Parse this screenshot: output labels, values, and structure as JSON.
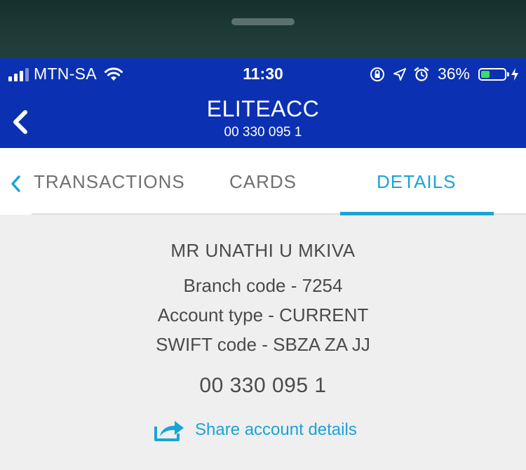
{
  "status_bar": {
    "carrier": "MTN-SA",
    "time": "11:30",
    "battery_percent": "36%",
    "battery_level": 0.36,
    "icons": [
      "signal-icon",
      "wifi-icon",
      "rotation-lock-icon",
      "location-icon",
      "alarm-icon",
      "battery-icon",
      "charging-icon"
    ]
  },
  "header": {
    "title": "ELITEACC",
    "account_number": "00 330 095 1"
  },
  "tabs": [
    {
      "label": "TRANSACTIONS",
      "active": false
    },
    {
      "label": "CARDS",
      "active": false
    },
    {
      "label": "DETAILS",
      "active": true
    }
  ],
  "details": {
    "holder_name": "MR UNATHI U MKIVA",
    "branch_code": "Branch code - 7254",
    "account_type": "Account type - CURRENT",
    "swift_code": "SWIFT code - SBZA ZA JJ",
    "account_number": "00 330 095 1",
    "share_label": "Share account details"
  },
  "colors": {
    "header_blue": "#0b31b2",
    "accent": "#1aa4d6",
    "battery_green": "#3ddc5b"
  }
}
